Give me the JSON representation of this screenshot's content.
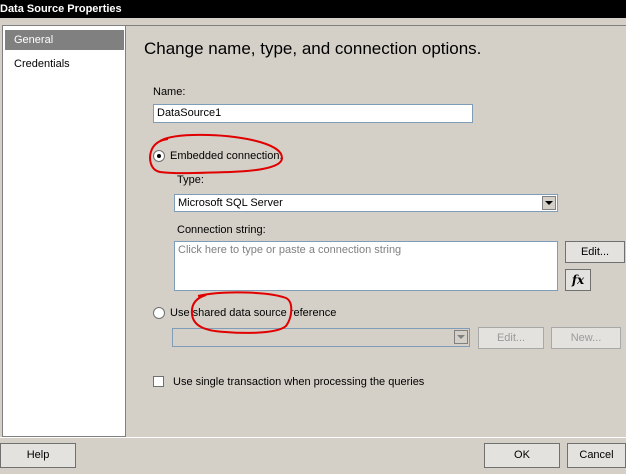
{
  "window": {
    "title": "Data Source Properties"
  },
  "sidebar": {
    "items": [
      {
        "label": "General"
      },
      {
        "label": "Credentials"
      }
    ]
  },
  "main": {
    "heading": "Change name, type, and connection options.",
    "name_label": "Name:",
    "name_value": "DataSource1",
    "embedded_label": "Embedded connection:",
    "type_label": "Type:",
    "type_value": "Microsoft SQL Server",
    "connection_label": "Connection string:",
    "connection_placeholder": "Click here to type or paste a connection string",
    "edit_label": "Edit...",
    "fx_label": "fx",
    "shared_label": "Use shared data source reference",
    "shared_value": "",
    "shared_edit_label": "Edit...",
    "shared_new_label": "New...",
    "single_transaction_label": "Use single transaction when processing the queries"
  },
  "footer": {
    "help_label": "Help",
    "ok_label": "OK",
    "cancel_label": "Cancel"
  },
  "colors": {
    "title_bg": "#000000",
    "selected_bg": "#808080",
    "annotation": "#e00000"
  }
}
